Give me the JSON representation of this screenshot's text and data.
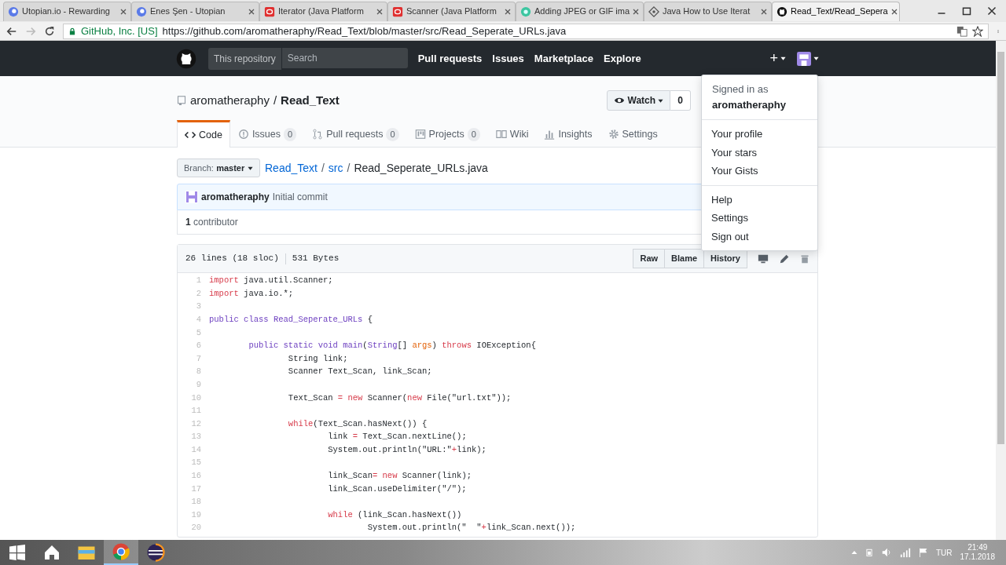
{
  "browser": {
    "tabs": [
      {
        "title": "Utopian.io - Rewarding",
        "selected": false
      },
      {
        "title": "Enes Şen - Utopian",
        "selected": false
      },
      {
        "title": "Iterator (Java Platform",
        "selected": false
      },
      {
        "title": "Scanner (Java Platform",
        "selected": false
      },
      {
        "title": "Adding JPEG or GIF ima",
        "selected": false
      },
      {
        "title": "Java How to Use Iterat",
        "selected": false
      },
      {
        "title": "Read_Text/Read_Sepera",
        "selected": true
      }
    ],
    "site_identity": "GitHub, Inc. [US]",
    "url": "https://github.com/aromatheraphy/Read_Text/blob/master/src/Read_Seperate_URLs.java"
  },
  "header": {
    "scope": "This repository",
    "search_placeholder": "Search",
    "nav": [
      "Pull requests",
      "Issues",
      "Marketplace",
      "Explore"
    ],
    "plus": "+"
  },
  "repo": {
    "owner": "aromatheraphy",
    "separator": "/",
    "name": "Read_Text",
    "watch": "Watch",
    "watch_count": "0",
    "tabs": [
      {
        "label": "Code",
        "selected": true
      },
      {
        "label": "Issues",
        "count": "0",
        "selected": false
      },
      {
        "label": "Pull requests",
        "count": "0",
        "selected": false
      },
      {
        "label": "Projects",
        "count": "0",
        "selected": false
      },
      {
        "label": "Wiki",
        "selected": false
      },
      {
        "label": "Insights",
        "selected": false
      },
      {
        "label": "Settings",
        "selected": false
      }
    ]
  },
  "file": {
    "branch_label": "Branch:",
    "branch": "master",
    "path": [
      {
        "text": "Read_Text",
        "kind": "link"
      },
      {
        "text": "/",
        "kind": "sep"
      },
      {
        "text": "src",
        "kind": "link"
      },
      {
        "text": "/",
        "kind": "sep"
      },
      {
        "text": "Read_Seperate_URLs.java",
        "kind": "final"
      }
    ],
    "commit_author": "aromatheraphy",
    "commit_message": "Initial commit",
    "contributors_count": "1",
    "contributors_label": "contributor",
    "lines_info": "26 lines (18 sloc)",
    "size": "531 Bytes",
    "buttons": [
      "Raw",
      "Blame",
      "History"
    ]
  },
  "code": [
    {
      "number": "1",
      "tokens": [
        {
          "text": "import",
          "kind": "keyword"
        },
        {
          "text": " java.util.Scanner;",
          "kind": "plain"
        }
      ]
    },
    {
      "number": "2",
      "tokens": [
        {
          "text": "import",
          "kind": "keyword"
        },
        {
          "text": " java.io.*;",
          "kind": "plain"
        }
      ]
    },
    {
      "number": "3"
    },
    {
      "number": "4",
      "tokens": [
        {
          "text": "public class Read_Seperate_URLs",
          "kind": "type"
        },
        {
          "text": " {",
          "kind": "plain"
        }
      ]
    },
    {
      "number": "5"
    },
    {
      "number": "6",
      "tokens": [
        {
          "text": "\tpublic static void main",
          "kind": "type"
        },
        {
          "text": "(",
          "kind": "plain"
        },
        {
          "text": "String",
          "kind": "type"
        },
        {
          "text": "[] ",
          "kind": "plain"
        },
        {
          "text": "args",
          "kind": "variable"
        },
        {
          "text": ") ",
          "kind": "plain"
        },
        {
          "text": "throws",
          "kind": "keyword"
        },
        {
          "text": " IOException{",
          "kind": "plain"
        }
      ]
    },
    {
      "number": "7",
      "tokens": [
        {
          "text": "\t\tString link;",
          "kind": "plain"
        }
      ]
    },
    {
      "number": "8",
      "tokens": [
        {
          "text": "\t\tScanner Text_Scan, link_Scan;",
          "kind": "plain"
        }
      ]
    },
    {
      "number": "9"
    },
    {
      "number": "10",
      "tokens": [
        {
          "text": "\t\tText_Scan ",
          "kind": "plain"
        },
        {
          "text": "= new",
          "kind": "keyword"
        },
        {
          "text": " Scanner(",
          "kind": "plain"
        },
        {
          "text": "new",
          "kind": "keyword"
        },
        {
          "text": " File(\"url.txt\"));",
          "kind": "plain"
        }
      ]
    },
    {
      "number": "11"
    },
    {
      "number": "12",
      "tokens": [
        {
          "text": "\t\twhile",
          "kind": "keyword"
        },
        {
          "text": "(Text_Scan.hasNext()) {",
          "kind": "plain"
        }
      ]
    },
    {
      "number": "13",
      "tokens": [
        {
          "text": "\t\t\tlink ",
          "kind": "plain"
        },
        {
          "text": "=",
          "kind": "keyword"
        },
        {
          "text": " Text_Scan.nextLine();",
          "kind": "plain"
        }
      ]
    },
    {
      "number": "14",
      "tokens": [
        {
          "text": "\t\t\tSystem.out.println(\"URL:\"",
          "kind": "plain"
        },
        {
          "text": "+",
          "kind": "keyword"
        },
        {
          "text": "link);",
          "kind": "plain"
        }
      ]
    },
    {
      "number": "15"
    },
    {
      "number": "16",
      "tokens": [
        {
          "text": "\t\t\tlink_Scan",
          "kind": "plain"
        },
        {
          "text": "= new",
          "kind": "keyword"
        },
        {
          "text": " Scanner(link);",
          "kind": "plain"
        }
      ]
    },
    {
      "number": "17",
      "tokens": [
        {
          "text": "\t\t\tlink_Scan.useDelimiter(\"/\");",
          "kind": "plain"
        }
      ]
    },
    {
      "number": "18"
    },
    {
      "number": "19",
      "tokens": [
        {
          "text": "\t\t\twhile",
          "kind": "keyword"
        },
        {
          "text": " (link_Scan.hasNext())",
          "kind": "plain"
        }
      ]
    },
    {
      "number": "20",
      "tokens": [
        {
          "text": "\t\t\t\tSystem.out.println(\"  \"",
          "kind": "plain"
        },
        {
          "text": "+",
          "kind": "keyword"
        },
        {
          "text": "link_Scan.next());",
          "kind": "plain"
        }
      ]
    }
  ],
  "user_menu": {
    "signed_in_label": "Signed in as",
    "username": "aromatheraphy",
    "groups": [
      [
        "Your profile",
        "Your stars",
        "Your Gists"
      ],
      [
        "Help",
        "Settings",
        "Sign out"
      ]
    ]
  },
  "taskbar": {
    "apps": [
      {
        "selected": false
      },
      {
        "selected": false
      },
      {
        "selected": true
      },
      {
        "selected": false
      }
    ],
    "language": "TUR",
    "time": "21:49",
    "date": "17.1.2018"
  }
}
